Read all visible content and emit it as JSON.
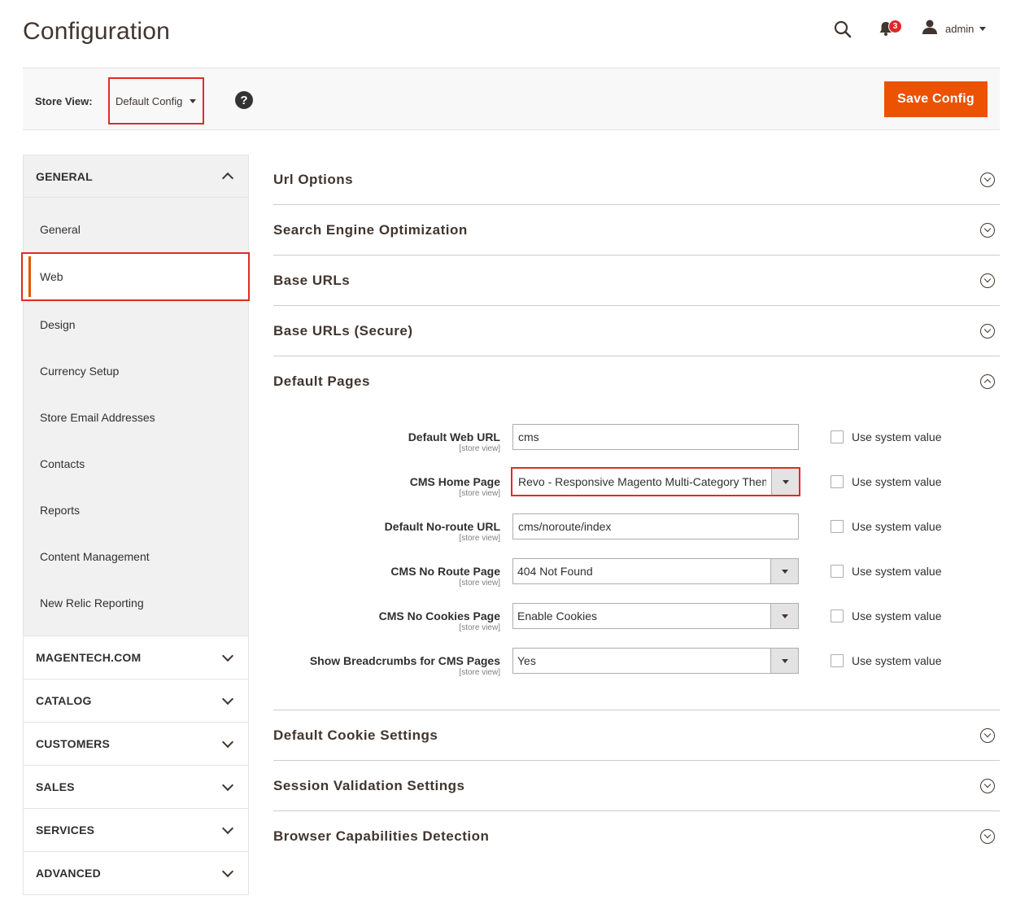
{
  "header": {
    "title": "Configuration",
    "notifications_count": "3",
    "user_name": "admin"
  },
  "store_bar": {
    "label": "Store View:",
    "selected": "Default Config",
    "help": "?",
    "save_label": "Save Config"
  },
  "sidebar": {
    "groups": [
      {
        "title": "GENERAL",
        "expanded": true,
        "items": [
          {
            "label": "General"
          },
          {
            "label": "Web",
            "active": true
          },
          {
            "label": "Design"
          },
          {
            "label": "Currency Setup"
          },
          {
            "label": "Store Email Addresses"
          },
          {
            "label": "Contacts"
          },
          {
            "label": "Reports"
          },
          {
            "label": "Content Management"
          },
          {
            "label": "New Relic Reporting"
          }
        ]
      },
      {
        "title": "MAGENTECH.COM"
      },
      {
        "title": "CATALOG"
      },
      {
        "title": "CUSTOMERS"
      },
      {
        "title": "SALES"
      },
      {
        "title": "SERVICES"
      },
      {
        "title": "ADVANCED"
      }
    ]
  },
  "sections": {
    "url_options": "Url Options",
    "seo": "Search Engine Optimization",
    "base_urls": "Base URLs",
    "base_urls_secure": "Base URLs (Secure)",
    "default_pages": "Default Pages",
    "cookie_settings": "Default Cookie Settings",
    "session_validation": "Session Validation Settings",
    "browser_capabilities": "Browser Capabilities Detection"
  },
  "default_pages": {
    "scope": "[store view]",
    "use_system_value": "Use system value",
    "fields": [
      {
        "label": "Default Web URL",
        "type": "input",
        "value": "cms"
      },
      {
        "label": "CMS Home Page",
        "type": "select",
        "value": "Revo - Responsive Magento Multi-Category Theme"
      },
      {
        "label": "Default No-route URL",
        "type": "input",
        "value": "cms/noroute/index"
      },
      {
        "label": "CMS No Route Page",
        "type": "select",
        "value": "404 Not Found"
      },
      {
        "label": "CMS No Cookies Page",
        "type": "select",
        "value": "Enable Cookies"
      },
      {
        "label": "Show Breadcrumbs for CMS Pages",
        "type": "select",
        "value": "Yes"
      }
    ]
  },
  "colors": {
    "accent": "#eb5202",
    "highlight": "#e02b27",
    "badge": "#e22626"
  }
}
